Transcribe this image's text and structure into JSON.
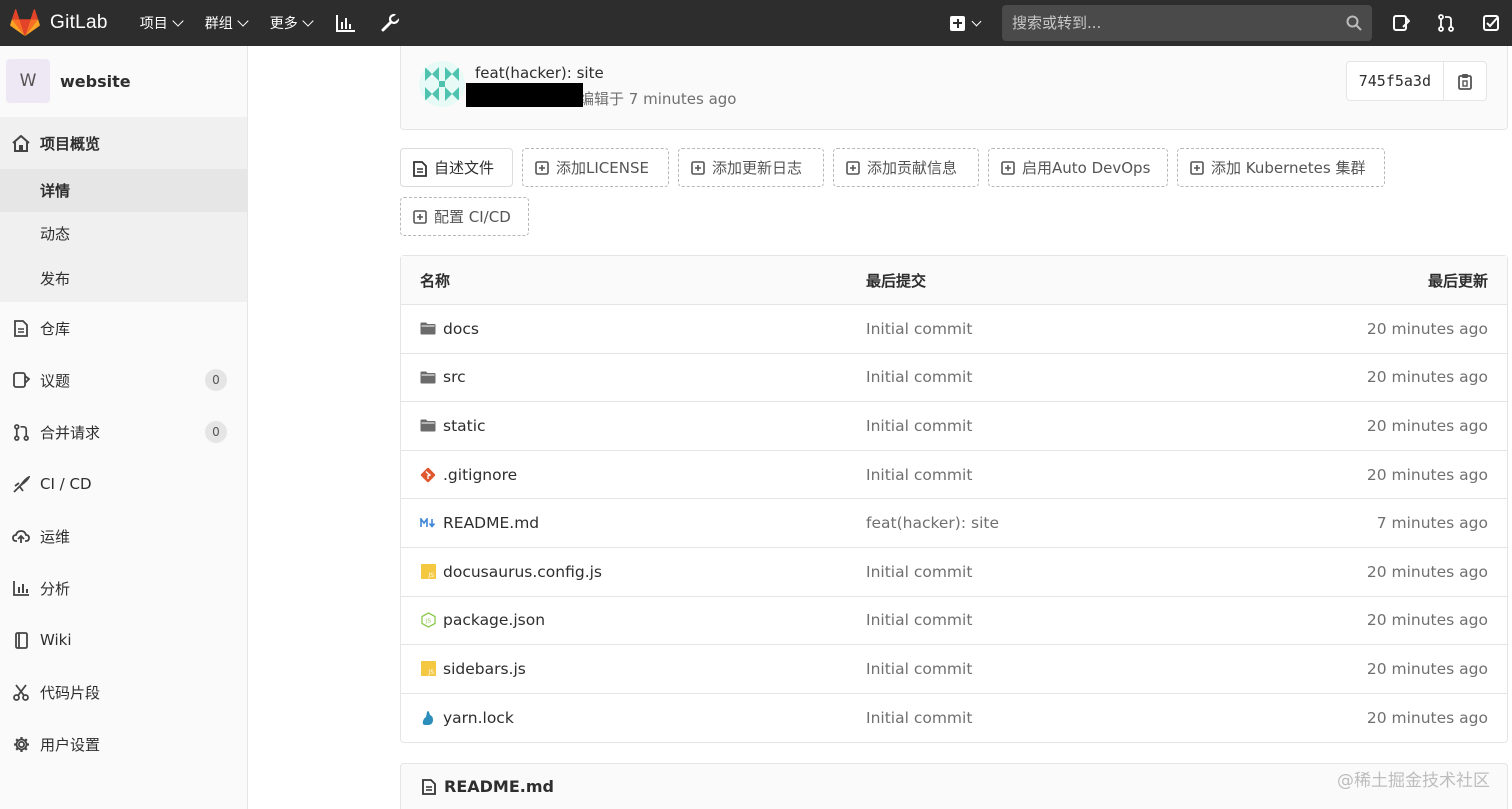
{
  "navbar": {
    "brand": "GitLab",
    "menu": [
      {
        "label": "项目"
      },
      {
        "label": "群组"
      },
      {
        "label": "更多"
      }
    ],
    "search_placeholder": "搜索或转到..."
  },
  "sidebar": {
    "avatar_letter": "W",
    "project_name": "website",
    "overview": {
      "label": "项目概览",
      "sub": [
        {
          "label": "详情"
        },
        {
          "label": "动态"
        },
        {
          "label": "发布"
        }
      ]
    },
    "items": [
      {
        "label": "仓库",
        "icon": "doc-icon"
      },
      {
        "label": "议题",
        "icon": "issues-icon",
        "badge": "0"
      },
      {
        "label": "合并请求",
        "icon": "merge-request-icon",
        "badge": "0"
      },
      {
        "label": "CI / CD",
        "icon": "rocket-icon"
      },
      {
        "label": "运维",
        "icon": "cloud-icon"
      },
      {
        "label": "分析",
        "icon": "chart-icon"
      },
      {
        "label": "Wiki",
        "icon": "book-icon"
      },
      {
        "label": "代码片段",
        "icon": "scissors-icon"
      },
      {
        "label": "用户设置",
        "icon": "gear-icon"
      }
    ]
  },
  "commit": {
    "title": "feat(hacker): site",
    "meta": "编辑于 7 minutes ago",
    "sha": "745f5a3d"
  },
  "actions": [
    {
      "label": "自述文件"
    },
    {
      "label": "添加LICENSE"
    },
    {
      "label": "添加更新日志"
    },
    {
      "label": "添加贡献信息"
    },
    {
      "label": "启用Auto DevOps"
    },
    {
      "label": "添加 Kubernetes 集群"
    },
    {
      "label": "配置 CI/CD"
    }
  ],
  "tree": {
    "headers": {
      "name": "名称",
      "commit": "最后提交",
      "updated": "最后更新"
    },
    "rows": [
      {
        "name": "docs",
        "icon": "folder-icon",
        "commit": "Initial commit",
        "time": "20 minutes ago"
      },
      {
        "name": "src",
        "icon": "folder-icon",
        "commit": "Initial commit",
        "time": "20 minutes ago"
      },
      {
        "name": "static",
        "icon": "folder-icon",
        "commit": "Initial commit",
        "time": "20 minutes ago"
      },
      {
        "name": ".gitignore",
        "icon": "git-icon",
        "commit": "Initial commit",
        "time": "20 minutes ago"
      },
      {
        "name": "README.md",
        "icon": "markdown-icon",
        "commit": "feat(hacker): site",
        "time": "7 minutes ago"
      },
      {
        "name": "docusaurus.config.js",
        "icon": "js-file-icon",
        "commit": "Initial commit",
        "time": "20 minutes ago"
      },
      {
        "name": "package.json",
        "icon": "nodejs-icon",
        "commit": "Initial commit",
        "time": "20 minutes ago"
      },
      {
        "name": "sidebars.js",
        "icon": "js-file-icon",
        "commit": "Initial commit",
        "time": "20 minutes ago"
      },
      {
        "name": "yarn.lock",
        "icon": "yarn-icon",
        "commit": "Initial commit",
        "time": "20 minutes ago"
      }
    ]
  },
  "readme_title": "README.md",
  "watermark": "@稀土掘金技术社区"
}
